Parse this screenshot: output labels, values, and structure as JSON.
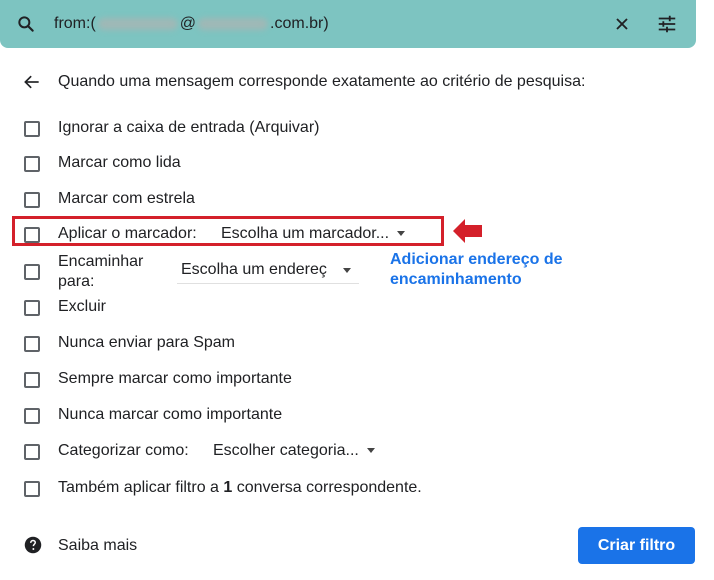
{
  "search": {
    "query_prefix": "from:(",
    "query_at": "@",
    "query_suffix": ".com.br)"
  },
  "header": {
    "text": "Quando uma mensagem corresponde exatamente ao critério de pesquisa:"
  },
  "options": {
    "skip_inbox": "Ignorar a caixa de entrada (Arquivar)",
    "mark_read": "Marcar como lida",
    "star": "Marcar com estrela",
    "apply_label": "Aplicar o marcador:",
    "apply_label_dropdown": "Escolha um marcador...",
    "forward_line1": "Encaminhar",
    "forward_line2": "para:",
    "forward_dropdown": "Escolha um endereç",
    "add_forward_line1": "Adicionar endereço de",
    "add_forward_line2": "encaminhamento",
    "delete": "Excluir",
    "never_spam": "Nunca enviar para Spam",
    "always_important": "Sempre marcar como importante",
    "never_important": "Nunca marcar como importante",
    "categorize": "Categorizar como:",
    "categorize_dropdown": "Escolher categoria...",
    "also_apply_prefix": "Também aplicar filtro a ",
    "also_apply_count": "1",
    "also_apply_suffix": " conversa correspondente."
  },
  "footer": {
    "learn_more": "Saiba mais",
    "create_filter": "Criar filtro"
  },
  "colors": {
    "search_bg": "#7dc4c1",
    "accent": "#1a73e8",
    "highlight": "#d4202a"
  },
  "icons": [
    "search-icon",
    "close-icon",
    "tune-icon",
    "back-arrow-icon",
    "help-icon",
    "red-arrow-icon"
  ]
}
